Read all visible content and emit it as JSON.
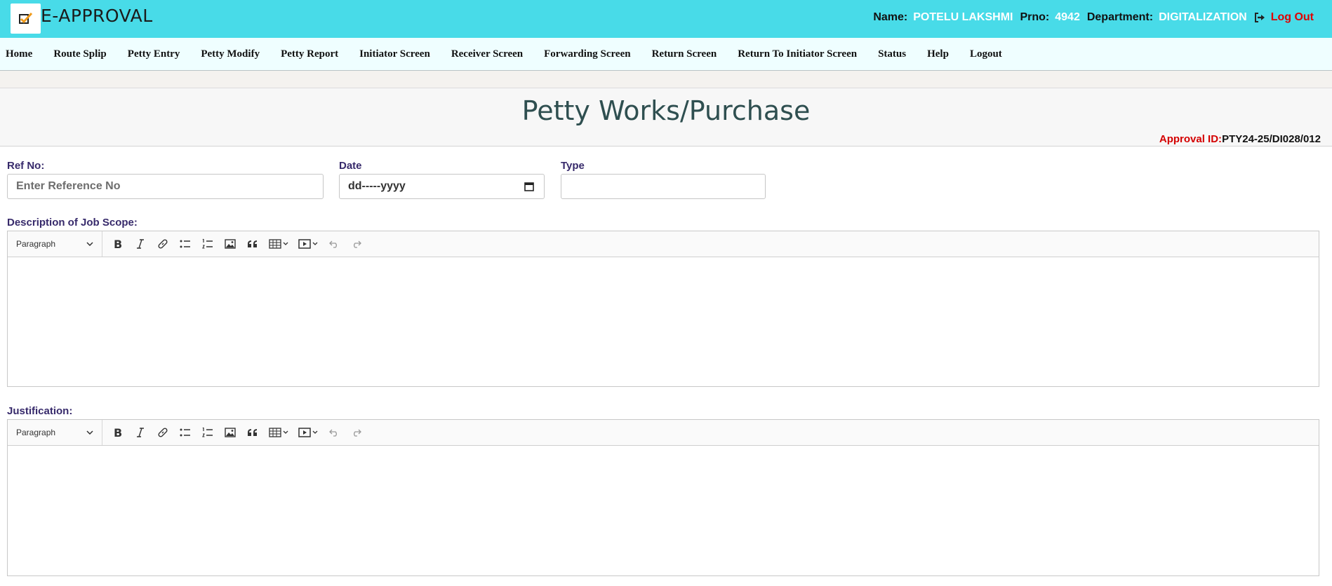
{
  "header": {
    "app_title": "E-APPROVAL",
    "name_label": "Name:",
    "name_value": "POTELU LAKSHMI",
    "prno_label": "Prno:",
    "prno_value": "4942",
    "dept_label": "Department:",
    "dept_value": "DIGITALIZATION",
    "logout_label": "Log Out"
  },
  "nav": {
    "items": [
      "Home",
      "Route Splip",
      "Petty Entry",
      "Petty Modify",
      "Petty Report",
      "Initiator Screen",
      "Receiver Screen",
      "Forwarding Screen",
      "Return Screen",
      "Return To Initiator Screen",
      "Status",
      "Help",
      "Logout"
    ]
  },
  "page": {
    "title": "Petty Works/Purchase",
    "approval_label": "Approval ID:",
    "approval_value": "PTY24-25/DI028/012"
  },
  "form": {
    "ref_label": "Ref No:",
    "ref_placeholder": "Enter Reference No",
    "date_label": "Date",
    "date_value": "dd-----yyyy",
    "type_label": "Type",
    "type_value": "",
    "description_label": "Description of Job Scope:",
    "justification_label": "Justification:",
    "paragraph_option": "Paragraph"
  },
  "icons": {
    "logo": "checklist-icon",
    "logout": "sign-out-icon",
    "toolbar": [
      "bold-icon",
      "italic-icon",
      "link-icon",
      "bulleted-list-icon",
      "numbered-list-icon",
      "image-icon",
      "blockquote-icon",
      "table-icon",
      "media-icon",
      "undo-icon",
      "redo-icon"
    ]
  },
  "colors": {
    "header_bg": "#48dbe8",
    "nav_bg": "#effeff",
    "title_color": "#2f4f50",
    "label_color": "#372a6b",
    "approval_label_color": "#d40000",
    "logout_color": "#e00000"
  }
}
